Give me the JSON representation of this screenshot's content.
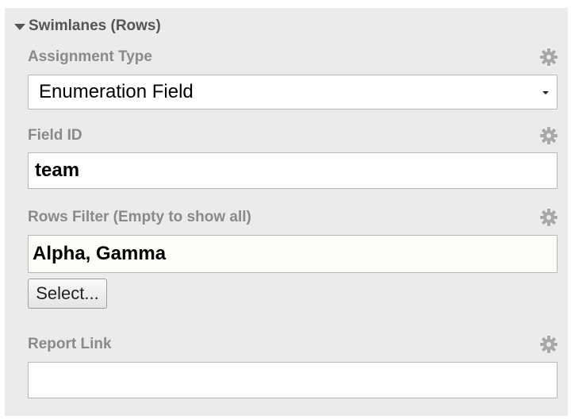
{
  "section": {
    "title": "Swimlanes (Rows)"
  },
  "fields": {
    "assignment_type": {
      "label": "Assignment Type",
      "value": "Enumeration Field"
    },
    "field_id": {
      "label": "Field ID",
      "value": "team"
    },
    "rows_filter": {
      "label": "Rows Filter (Empty to show all)",
      "value": "Alpha, Gamma",
      "button_label": "Select..."
    },
    "report_link": {
      "label": "Report Link",
      "value": ""
    }
  },
  "icons": {
    "section_toggle": "triangle-down-icon",
    "settings": "gear-icon"
  },
  "colors": {
    "panel_background": "#ebebeb",
    "label_text": "#8a8a8a",
    "header_text": "#555555",
    "input_border": "#b8b8b8"
  }
}
